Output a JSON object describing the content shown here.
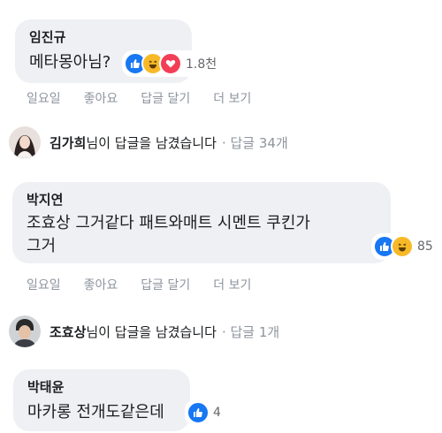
{
  "comments": [
    {
      "name": "임진규",
      "text": "메타몽아님?",
      "reaction_count": "1.8천",
      "reactions": [
        "like-icon",
        "haha-icon",
        "love-icon"
      ],
      "actions": [
        "일요일",
        "좋아요",
        "답글 달기",
        "더 보기"
      ]
    },
    {
      "reply_summary": {
        "name": "김가희",
        "text": "님이 답글을 남겼습니다",
        "meta": "· 답글 34개"
      }
    },
    {
      "name": "박지연",
      "text_line1": "조효상 그거같다 패트와매트 시멘트 쿠킨가",
      "text_line2": "그거",
      "reaction_count": "85",
      "reactions": [
        "like-icon",
        "haha-icon"
      ],
      "actions": [
        "일요일",
        "좋아요",
        "답글 달기",
        "더 보기"
      ]
    },
    {
      "reply_summary": {
        "name": "조효상",
        "text": "님이 답글을 남겼습니다",
        "meta": "· 답글 1개"
      }
    },
    {
      "name": "박태윤",
      "text": "마카롱 전개도같은데",
      "reaction_count": "4",
      "reactions": [
        "like-icon"
      ]
    }
  ],
  "colors": {
    "bubble": "#eef0f3",
    "like": "#1877f2",
    "haha": "#f7b928",
    "love": "#f33e58",
    "muted": "#8d949e"
  }
}
